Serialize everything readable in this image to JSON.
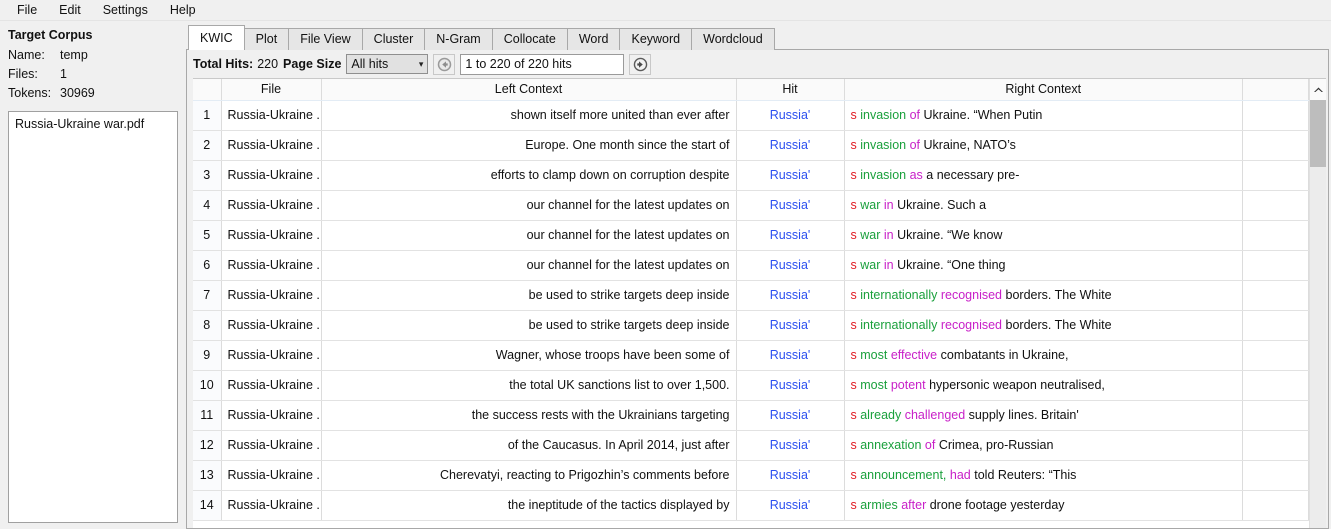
{
  "menu": {
    "items": [
      "File",
      "Edit",
      "Settings",
      "Help"
    ]
  },
  "sidebar": {
    "title": "Target Corpus",
    "name_label": "Name:",
    "name_value": "temp",
    "files_label": "Files:",
    "files_value": "1",
    "tokens_label": "Tokens:",
    "tokens_value": "30969",
    "files": [
      "Russia-Ukraine war.pdf"
    ]
  },
  "tabs": [
    {
      "label": "KWIC",
      "active": true
    },
    {
      "label": "Plot",
      "active": false
    },
    {
      "label": "File View",
      "active": false
    },
    {
      "label": "Cluster",
      "active": false
    },
    {
      "label": "N-Gram",
      "active": false
    },
    {
      "label": "Collocate",
      "active": false
    },
    {
      "label": "Word",
      "active": false
    },
    {
      "label": "Keyword",
      "active": false
    },
    {
      "label": "Wordcloud",
      "active": false
    }
  ],
  "toolbar": {
    "total_hits_label": "Total Hits:",
    "total_hits_value": "220",
    "page_size_label": "Page Size",
    "page_size_value": "All hits",
    "page_size_options": [
      "All hits"
    ],
    "caret": "⌄",
    "hits_range": "1 to 220 of 220 hits",
    "prev_title": "Previous page",
    "next_title": "Next page"
  },
  "table": {
    "headers": {
      "index": "",
      "file": "File",
      "left_context": "Left Context",
      "hit": "Hit",
      "right_context": "Right Context"
    },
    "rows": [
      {
        "n": "1",
        "file": "Russia-Ukraine ...",
        "left": "shown itself more united than ever after",
        "hit": "Russia'",
        "rc_s": "s",
        "rc_g": "invasion",
        "rc_m": "of",
        "rc_n": "Ukraine. “When Putin"
      },
      {
        "n": "2",
        "file": "Russia-Ukraine ...",
        "left": "Europe. One month since the start of",
        "hit": "Russia'",
        "rc_s": "s",
        "rc_g": "invasion",
        "rc_m": "of",
        "rc_n": "Ukraine, NATO’s"
      },
      {
        "n": "3",
        "file": "Russia-Ukraine ...",
        "left": "efforts to clamp down on corruption despite",
        "hit": "Russia'",
        "rc_s": "s",
        "rc_g": "invasion",
        "rc_m": "as",
        "rc_n": "a necessary pre-"
      },
      {
        "n": "4",
        "file": "Russia-Ukraine ...",
        "left": "our channel for the latest updates on",
        "hit": "Russia'",
        "rc_s": "s",
        "rc_g": "war",
        "rc_m": "in",
        "rc_n": "Ukraine. Such a"
      },
      {
        "n": "5",
        "file": "Russia-Ukraine ...",
        "left": "our channel for the latest updates on",
        "hit": "Russia'",
        "rc_s": "s",
        "rc_g": "war",
        "rc_m": "in",
        "rc_n": "Ukraine. “We know"
      },
      {
        "n": "6",
        "file": "Russia-Ukraine ...",
        "left": "our channel for the latest updates on",
        "hit": "Russia'",
        "rc_s": "s",
        "rc_g": "war",
        "rc_m": "in",
        "rc_n": "Ukraine. “One thing"
      },
      {
        "n": "7",
        "file": "Russia-Ukraine ...",
        "left": "be used to strike targets deep inside",
        "hit": "Russia'",
        "rc_s": "s",
        "rc_g": "internationally",
        "rc_m": "recognised",
        "rc_n": "borders. The White"
      },
      {
        "n": "8",
        "file": "Russia-Ukraine ...",
        "left": "be used to strike targets deep inside",
        "hit": "Russia'",
        "rc_s": "s",
        "rc_g": "internationally",
        "rc_m": "recognised",
        "rc_n": "borders. The White"
      },
      {
        "n": "9",
        "file": "Russia-Ukraine ...",
        "left": "Wagner, whose troops have been some of",
        "hit": "Russia'",
        "rc_s": "s",
        "rc_g": "most",
        "rc_m": "effective",
        "rc_n": "combatants in Ukraine,"
      },
      {
        "n": "10",
        "file": "Russia-Ukraine ...",
        "left": "the total UK sanctions list to over 1,500.",
        "hit": "Russia'",
        "rc_s": "s",
        "rc_g": "most",
        "rc_m": "potent",
        "rc_n": "hypersonic weapon neutralised,"
      },
      {
        "n": "11",
        "file": "Russia-Ukraine ...",
        "left": "the success rests with the Ukrainians targeting",
        "hit": "Russia'",
        "rc_s": "s",
        "rc_g": "already",
        "rc_m": "challenged",
        "rc_n": "supply lines. Britain'"
      },
      {
        "n": "12",
        "file": "Russia-Ukraine ...",
        "left": "of the Caucasus. In April 2014, just after",
        "hit": "Russia'",
        "rc_s": "s",
        "rc_g": "annexation",
        "rc_m": "of",
        "rc_n": "Crimea, pro-Russian"
      },
      {
        "n": "13",
        "file": "Russia-Ukraine ...",
        "left": "Cherevatyi, reacting to Prigozhin’s comments before",
        "hit": "Russia'",
        "rc_s": "s",
        "rc_g": "announcement,",
        "rc_m": "had",
        "rc_n": "told Reuters: “This"
      },
      {
        "n": "14",
        "file": "Russia-Ukraine ...",
        "left": "the ineptitude of the tactics displayed by",
        "hit": "Russia'",
        "rc_s": "s",
        "rc_g": "armies",
        "rc_m": "after",
        "rc_n": "drone footage yesterday"
      }
    ]
  },
  "colors": {
    "hit": "#2b4ff0",
    "right_s": "#e01b24",
    "right_first": "#1aa03c",
    "right_second": "#c820c8",
    "window_bg": "#f0f0f0"
  }
}
